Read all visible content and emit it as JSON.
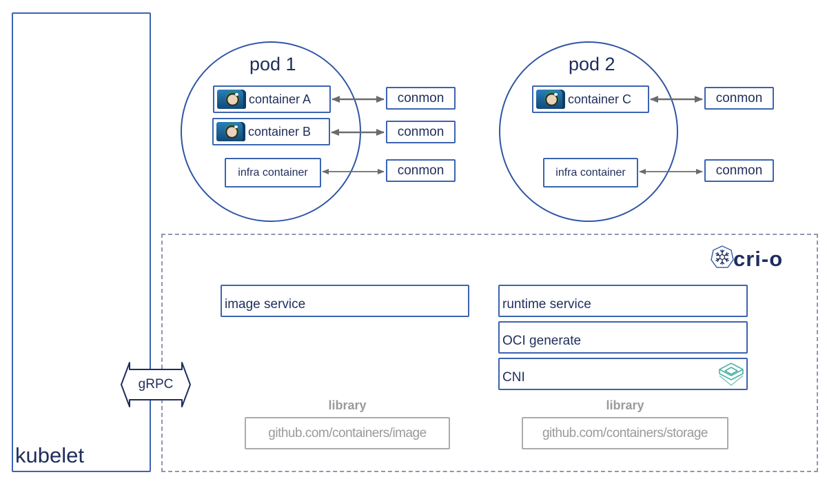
{
  "kubelet": {
    "label": "kubelet"
  },
  "grpc": {
    "label": "gRPC"
  },
  "pods": [
    {
      "title": "pod 1",
      "containers": [
        {
          "label": "container A",
          "icon": "container-icon"
        },
        {
          "label": "container B",
          "icon": "container-icon"
        }
      ],
      "infra": {
        "label": "infra container"
      },
      "conmons": [
        "conmon",
        "conmon",
        "conmon"
      ]
    },
    {
      "title": "pod 2",
      "containers": [
        {
          "label": "container C",
          "icon": "container-icon"
        }
      ],
      "infra": {
        "label": "infra container"
      },
      "conmons": [
        "conmon",
        "conmon"
      ]
    }
  ],
  "crio": {
    "logo_text": "cri-o",
    "logo_icon": "snowflake-heptagon-icon",
    "image_service": {
      "label": "image service"
    },
    "runtime_stack": [
      {
        "label": "runtime service"
      },
      {
        "label": "OCI generate"
      },
      {
        "label": "CNI",
        "icon": "cni-icon"
      }
    ],
    "libraries": [
      {
        "heading": "library",
        "name": "github.com/containers/image"
      },
      {
        "heading": "library",
        "name": "github.com/containers/storage"
      }
    ]
  },
  "colors": {
    "border_blue": "#3b63b0",
    "text_navy": "#1f2d5c",
    "arrow_gray": "#6b6b6b",
    "dashed_gray": "#8e97b1",
    "library_gray": "#9a9a9a",
    "cni_teal": "#4fb3a7"
  }
}
